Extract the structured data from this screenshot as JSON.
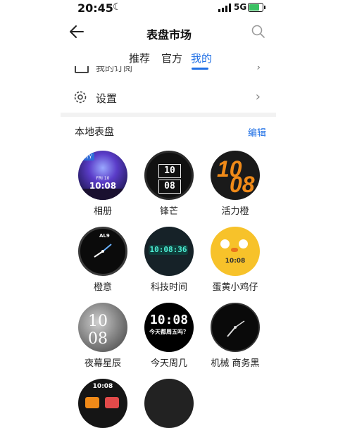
{
  "status": {
    "time": "20:45",
    "network": "5G"
  },
  "header": {
    "title": "表盘市场"
  },
  "tabs": [
    {
      "label": "推荐"
    },
    {
      "label": "官方"
    },
    {
      "label": "我的"
    }
  ],
  "partial_row": {
    "label": "我的订阅"
  },
  "settings_row": {
    "label": "设置"
  },
  "section": {
    "title": "本地表盘",
    "edit_label": "编辑"
  },
  "faces": [
    {
      "name": "相册",
      "diy": "DIY",
      "time": "10:08",
      "date": "FRI 10"
    },
    {
      "name": "锋芒",
      "top": "10",
      "bottom": "08"
    },
    {
      "name": "活力橙",
      "top": "10",
      "bottom": "08"
    },
    {
      "name": "橙意",
      "badge": "AL9"
    },
    {
      "name": "科技时间",
      "time": "10:08:36"
    },
    {
      "name": "蛋黄小鸡仔",
      "time": "10:08"
    },
    {
      "name": "夜幕星辰",
      "time": "10 08"
    },
    {
      "name": "今天周几",
      "time": "10:08",
      "sub": "今天都周五吗？"
    },
    {
      "name": "机械 商务黑"
    },
    {
      "name": "",
      "time": "10:08"
    },
    {
      "name": ""
    }
  ],
  "colors": {
    "accent": "#1f6fe5"
  }
}
